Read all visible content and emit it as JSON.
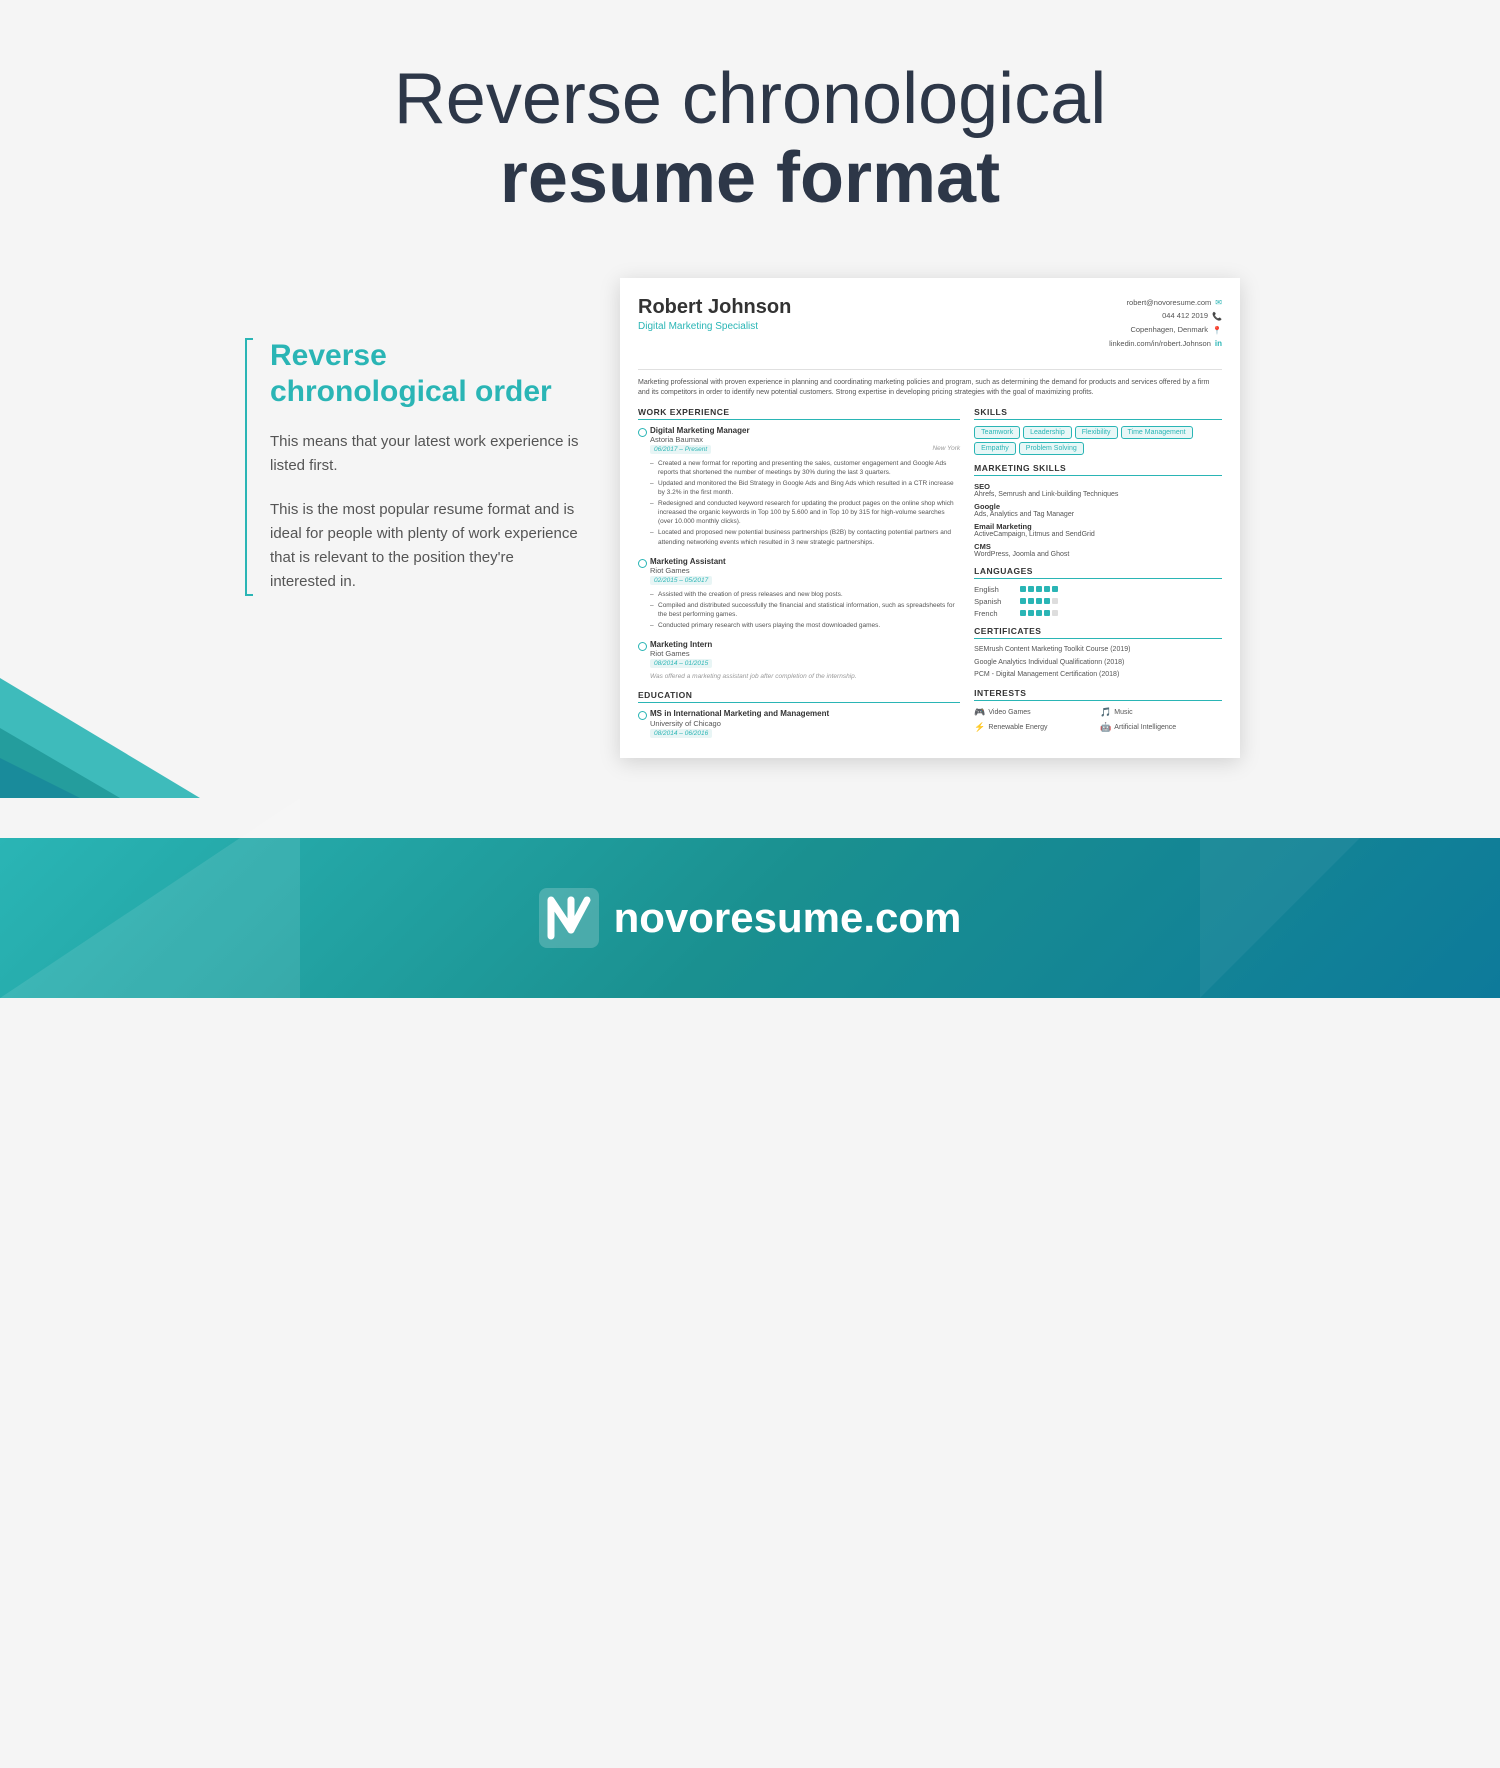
{
  "page": {
    "title_light": "Reverse chronological",
    "title_bold": "resume format"
  },
  "sidebar": {
    "heading": "Reverse chronological order",
    "paragraph1": "This means that your latest work experience is listed first.",
    "paragraph2": "This is the most popular resume format and is ideal for people with plenty of work experience that is relevant to the position they're interested in."
  },
  "resume": {
    "name": "Robert Johnson",
    "title": "Digital Marketing Specialist",
    "contact": {
      "email": "robert@novoresume.com",
      "phone": "044 412 2019",
      "location": "Copenhagen, Denmark",
      "linkedin": "linkedin.com/in/robert.Johnson"
    },
    "summary": "Marketing professional with proven experience in planning and coordinating marketing policies and program, such as determining the demand for products and services offered by a firm and its competitors in order to identify new potential customers. Strong expertise in developing pricing strategies with the goal of maximizing profits.",
    "work_experience": {
      "section_title": "WORK EXPERIENCE",
      "jobs": [
        {
          "title": "Digital Marketing Manager",
          "company": "Astoria Baumax",
          "dates": "06/2017 – Present",
          "location": "New York",
          "bullets": [
            "Created a new format for reporting and presenting the sales, customer engagement and Google Ads reports that shortened the number of meetings by 30% during the last 3 quarters.",
            "Updated and monitored the Bid Strategy in Google Ads and Bing Ads which resulted in a CTR increase by 3.2% in the first month.",
            "Redesigned and conducted keyword research for updating the product pages on the online shop which increased the organic keywords in Top 100 by 5.600 and in Top 10 by 315 for high-volume searches (over 10.000 monthly clicks).",
            "Located and proposed new potential business partnerships (B2B) by contacting potential partners and attending networking events which resulted in 3 new strategic partnerships."
          ]
        },
        {
          "title": "Marketing Assistant",
          "company": "Riot Games",
          "dates": "02/2015 – 05/2017",
          "location": "",
          "bullets": [
            "Assisted with the creation of press releases and new blog posts.",
            "Compiled and distributed successfully the financial and statistical information, such as spreadsheets for the best performing games.",
            "Conducted primary research with users playing the most downloaded games."
          ]
        },
        {
          "title": "Marketing Intern",
          "company": "Riot Games",
          "dates": "08/2014 – 01/2015",
          "location": "",
          "note": "Was offered a marketing assistant job after completion of the internship.",
          "bullets": []
        }
      ]
    },
    "education": {
      "section_title": "EDUCATION",
      "items": [
        {
          "degree": "MS in International Marketing and Management",
          "school": "University of Chicago",
          "dates": "08/2014 – 06/2016"
        }
      ]
    },
    "skills": {
      "section_title": "SKILLS",
      "tags": [
        "Teamwork",
        "Leadership",
        "Flexibility",
        "Time Management",
        "Empathy",
        "Problem Solving"
      ]
    },
    "marketing_skills": {
      "section_title": "MARKETING SKILLS",
      "items": [
        {
          "title": "SEO",
          "desc": "Ahrefs, Semrush and Link-building Techniques"
        },
        {
          "title": "Google",
          "desc": "Ads, Analytics and Tag Manager"
        },
        {
          "title": "Email Marketing",
          "desc": "ActiveCampaign, Litmus and SendGrid"
        },
        {
          "title": "CMS",
          "desc": "WordPress, Joomla and Ghost"
        }
      ]
    },
    "languages": {
      "section_title": "LANGUAGES",
      "items": [
        {
          "name": "English",
          "level": 5
        },
        {
          "name": "Spanish",
          "level": 4
        },
        {
          "name": "French",
          "level": 4
        }
      ]
    },
    "certificates": {
      "section_title": "CERTIFICATES",
      "items": [
        "SEMrush Content Marketing Toolkit Course (2019)",
        "Google Analytics Individual Qualificationn (2018)",
        "PCM - Digital Management Certification (2018)"
      ]
    },
    "interests": {
      "section_title": "INTERESTS",
      "items": [
        {
          "icon": "🎮",
          "label": "Video Games"
        },
        {
          "icon": "🎵",
          "label": "Music"
        },
        {
          "icon": "⚡",
          "label": "Renewable Energy"
        },
        {
          "icon": "🤖",
          "label": "Artificial Intelligence"
        }
      ]
    }
  },
  "footer": {
    "brand": "novoresume.com"
  }
}
